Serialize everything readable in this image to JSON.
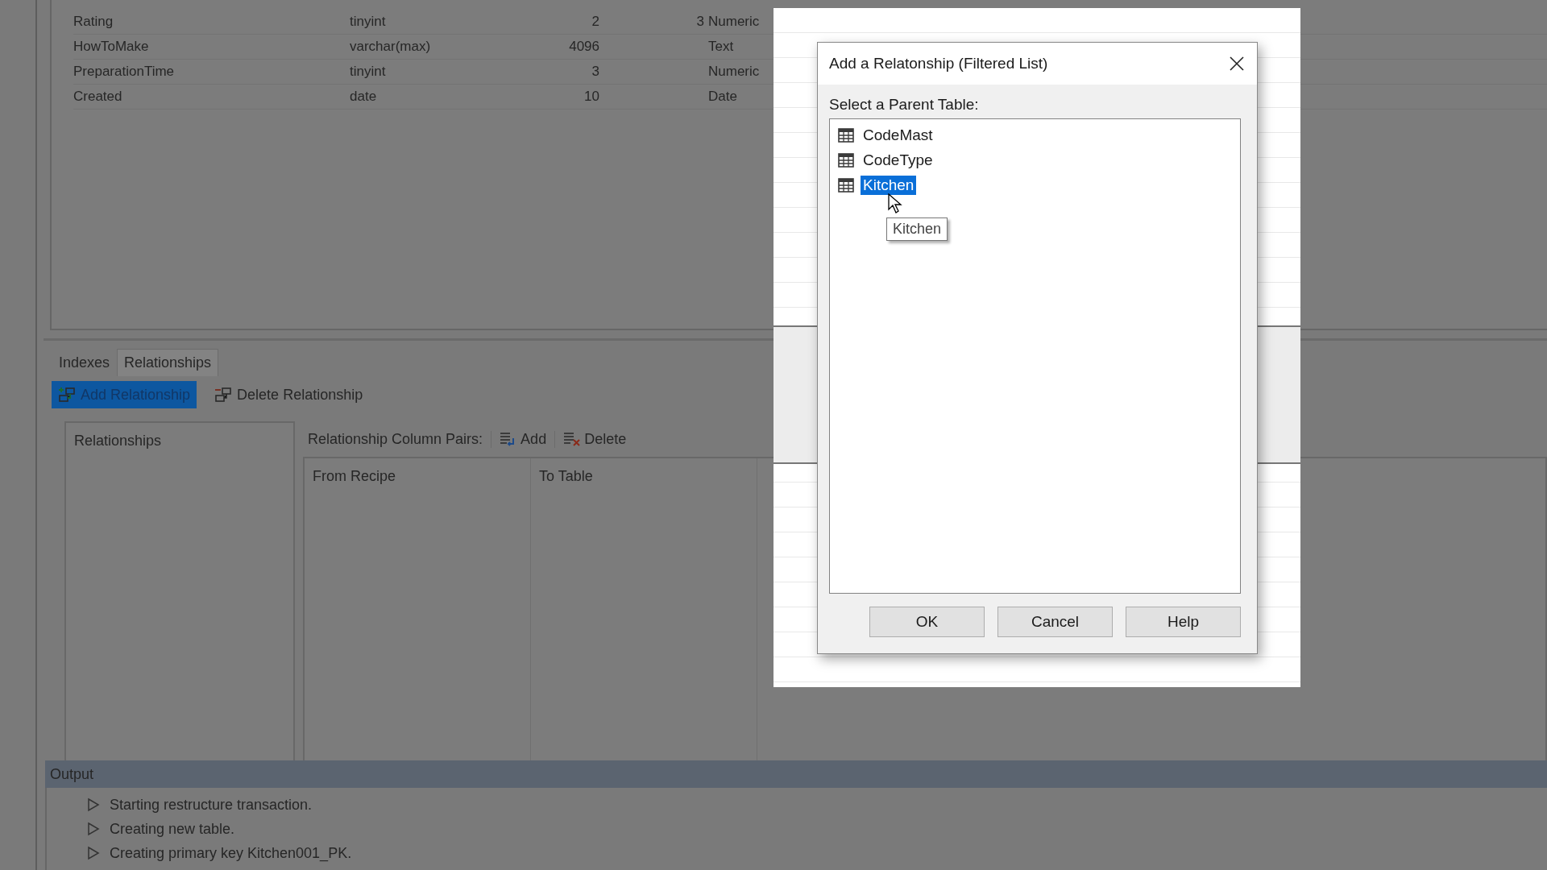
{
  "columns_grid": {
    "rows": [
      {
        "name": "Rating",
        "type": "tinyint",
        "length": "2",
        "decimals": "3",
        "category": "Numeric"
      },
      {
        "name": "HowToMake",
        "type": "varchar(max)",
        "length": "4096",
        "category": "Text"
      },
      {
        "name": "PreparationTime",
        "type": "tinyint",
        "length": "3",
        "category": "Numeric"
      },
      {
        "name": "Created",
        "type": "date",
        "length": "10",
        "category": "Date"
      }
    ]
  },
  "tabs": [
    {
      "label": "Indexes",
      "selected": false
    },
    {
      "label": "Relationships",
      "selected": true
    }
  ],
  "toolbar": [
    {
      "label": "Add Relationship",
      "kind": "add",
      "selected": true
    },
    {
      "label": "Delete Relationship",
      "kind": "delete",
      "selected": false
    }
  ],
  "relationships_panel": {
    "title": "Relationships"
  },
  "column_pairs": {
    "label": "Relationship Column Pairs:",
    "actions": [
      {
        "label": "Add",
        "kind": "add"
      },
      {
        "label": "Delete",
        "kind": "delete"
      }
    ],
    "columns": [
      "From Recipe",
      "To Table"
    ]
  },
  "output": {
    "title": "Output",
    "lines": [
      "Starting restructure transaction.",
      "Creating new table.",
      "Creating primary key Kitchen001_PK."
    ]
  },
  "dialog": {
    "title": "Add a Relatonship (Filtered List)",
    "prompt": "Select a Parent Table:",
    "tables": [
      {
        "name": "CodeMast",
        "selected": false
      },
      {
        "name": "CodeType",
        "selected": false
      },
      {
        "name": "Kitchen",
        "selected": true
      }
    ],
    "tooltip": "Kitchen",
    "buttons": [
      "OK",
      "Cancel",
      "Help"
    ]
  }
}
